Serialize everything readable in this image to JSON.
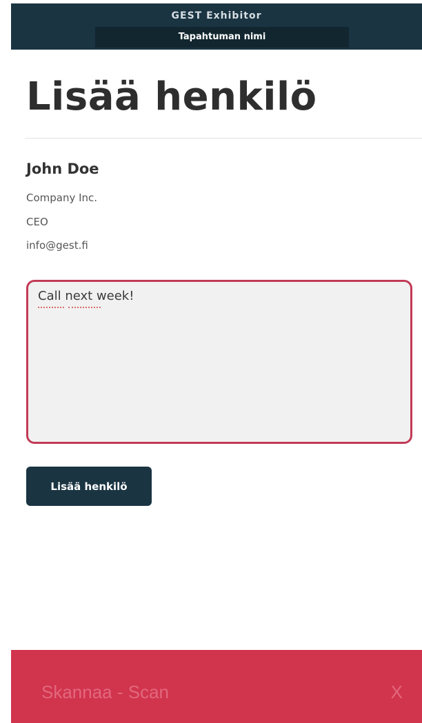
{
  "header": {
    "app_title": "GEST Exhibitor",
    "event_name": "Tapahtuman nimi"
  },
  "main": {
    "page_title": "Lisää henkilö",
    "contact": {
      "name": "John Doe",
      "company": "Company Inc.",
      "role": "CEO",
      "email": "info@gest.fi"
    },
    "note": {
      "value": "Call next week!"
    },
    "add_button_label": "Lisää henkilö"
  },
  "scan_bar": {
    "label": "Skannaa - Scan",
    "close_label": "X"
  },
  "colors": {
    "header_bg": "#1a3442",
    "accent_red": "#d1344d",
    "note_border": "#c23a55"
  }
}
